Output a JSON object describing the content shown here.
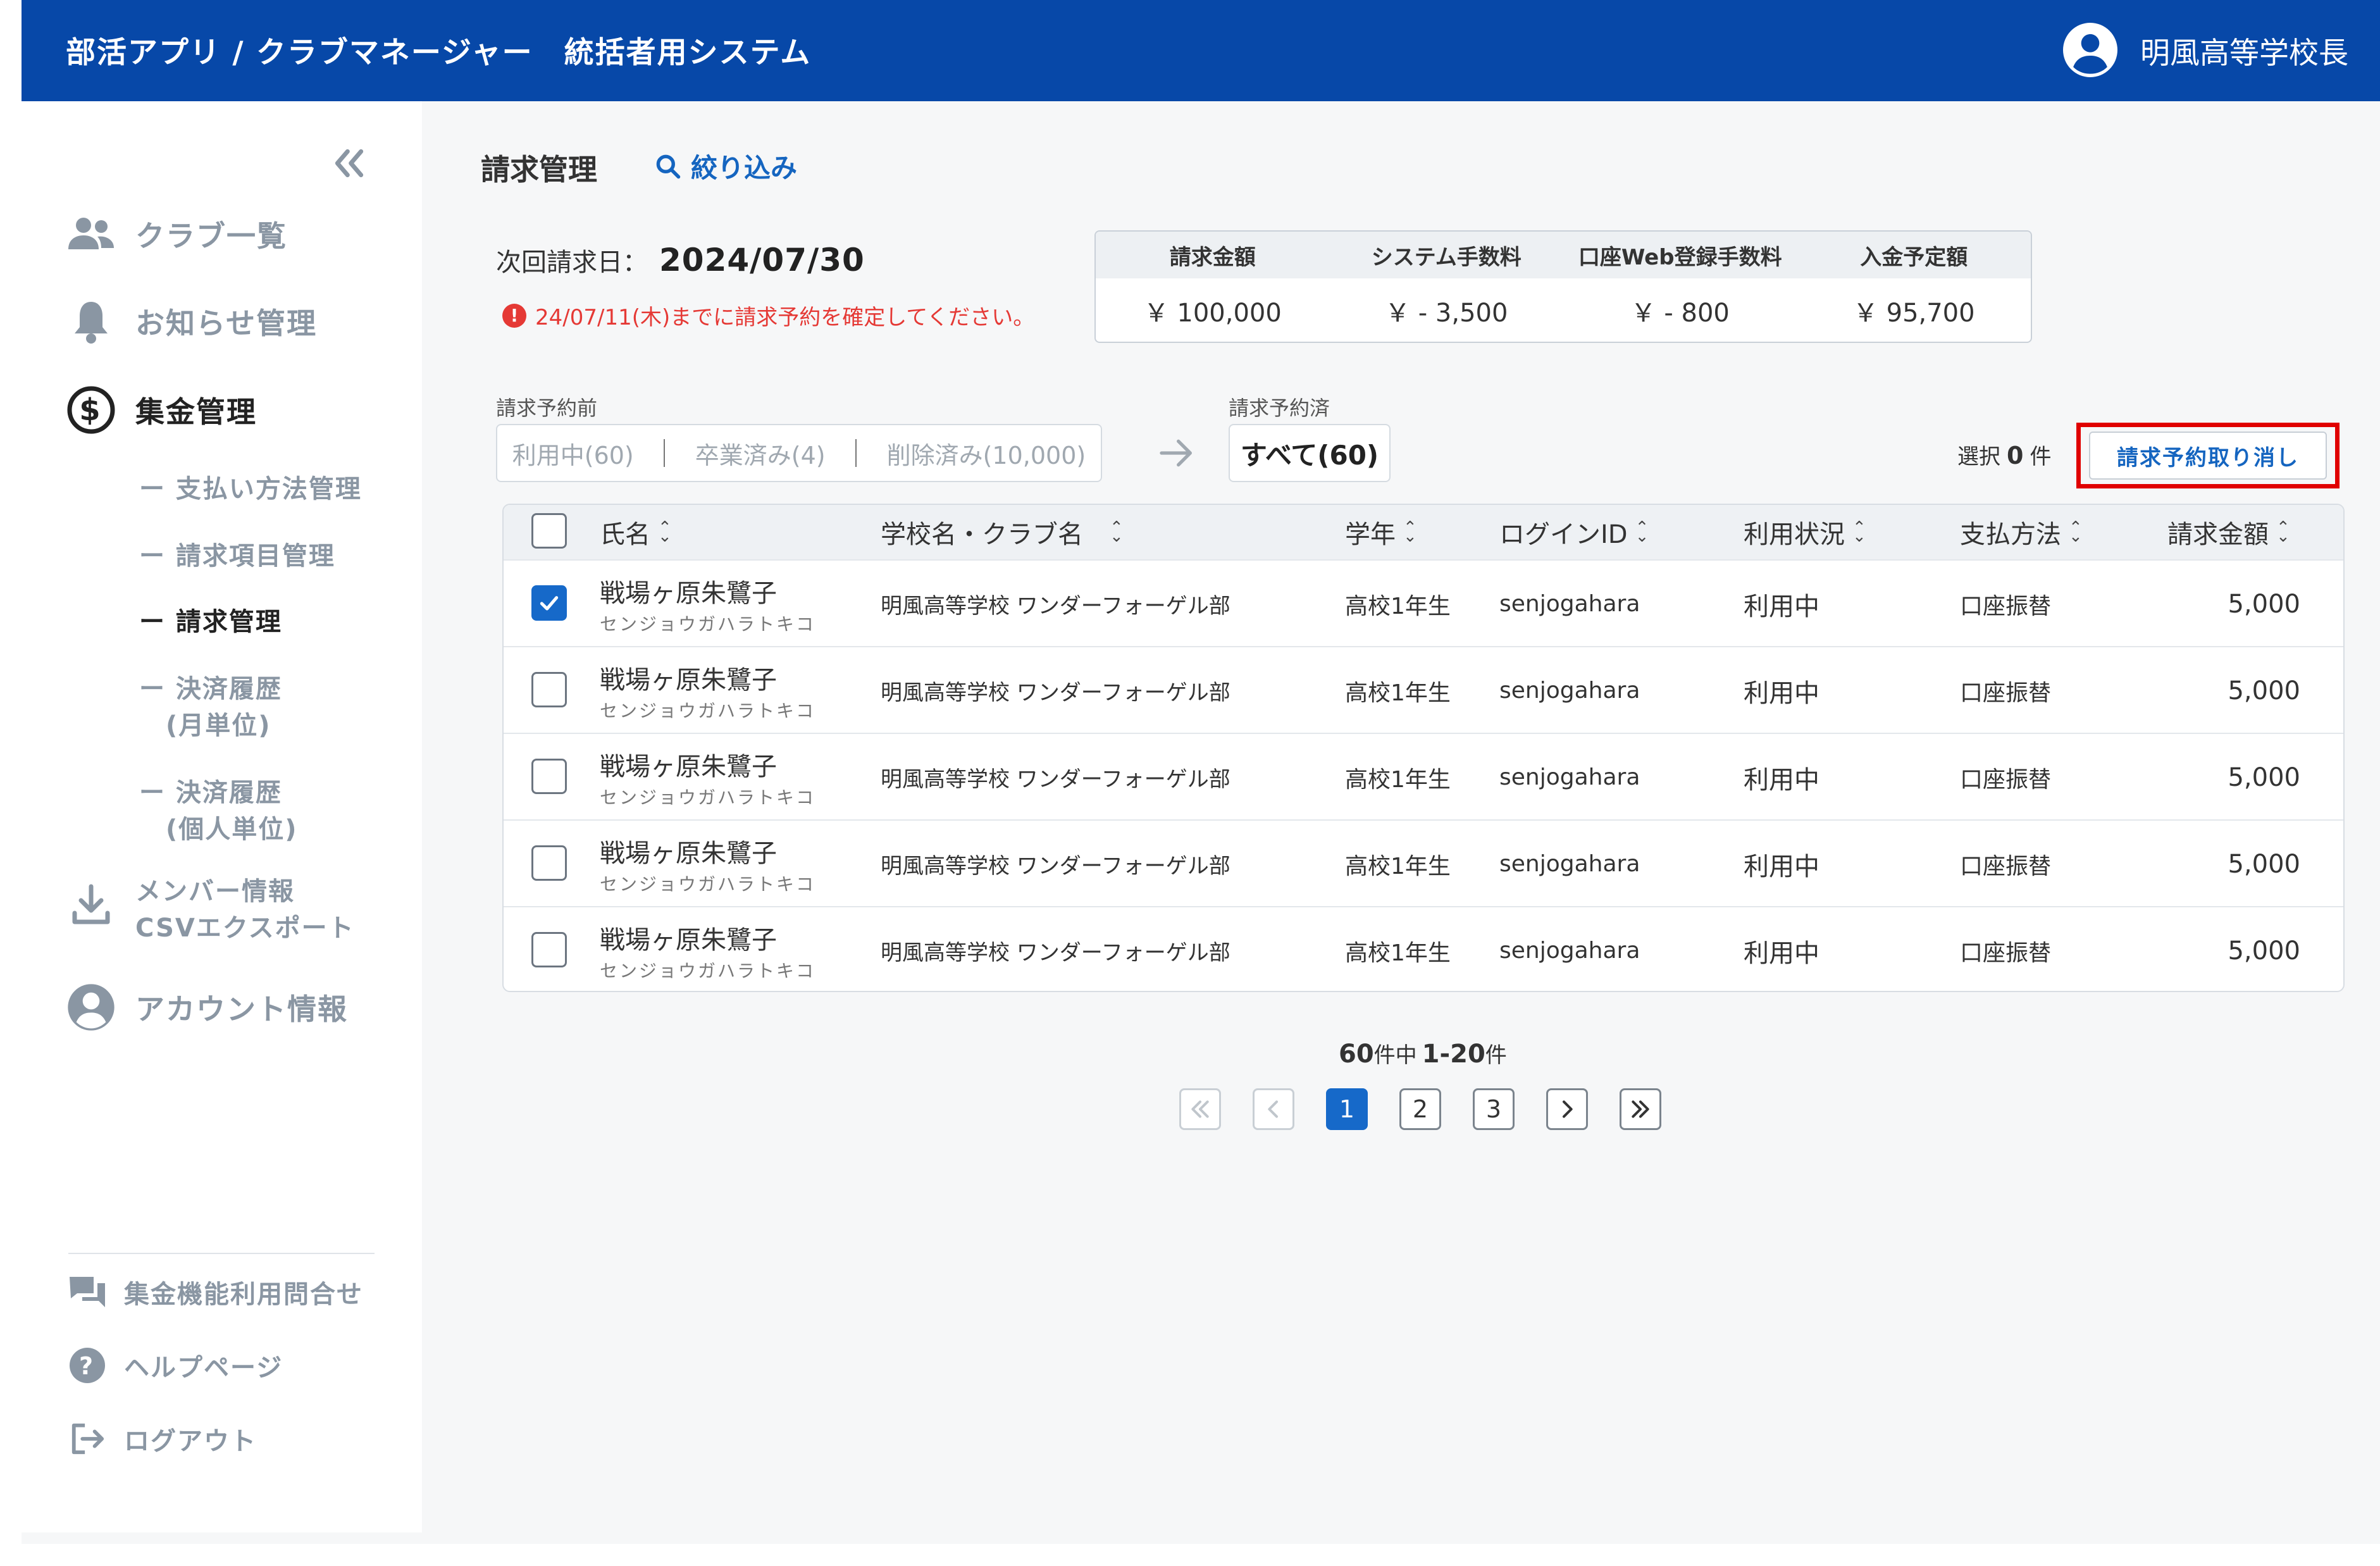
{
  "header": {
    "title": "部活アプリ / クラブマネージャー　統括者用システム",
    "user_name": "明風高等学校長"
  },
  "sidebar": {
    "items": [
      {
        "label": "クラブ一覧",
        "icon": "users-icon"
      },
      {
        "label": "お知らせ管理",
        "icon": "bell-icon"
      },
      {
        "label": "集金管理",
        "icon": "dollar-icon"
      },
      {
        "label": "メンバー情報",
        "label2": "CSVエクスポート",
        "icon": "download-icon"
      },
      {
        "label": "アカウント情報",
        "icon": "account-icon"
      }
    ],
    "subitems": [
      {
        "label": "ー 支払い方法管理"
      },
      {
        "label": "ー 請求項目管理"
      },
      {
        "label": "ー 請求管理"
      },
      {
        "label": "ー 決済履歴",
        "label2": "(月単位)"
      },
      {
        "label": "ー 決済履歴",
        "label2": "(個人単位)"
      }
    ],
    "bottom": [
      {
        "label": "集金機能利用問合せ",
        "icon": "chat-icon"
      },
      {
        "label": "ヘルプページ",
        "icon": "help-icon"
      },
      {
        "label": "ログアウト",
        "icon": "logout-icon"
      }
    ]
  },
  "main": {
    "title": "請求管理",
    "filter_label": "絞り込み",
    "next_date_label": "次回請求日：",
    "next_date_value": "2024/07/30",
    "warning": "24/07/11(木)までに請求予約を確定してください。",
    "summary": {
      "headers": [
        "請求金額",
        "システム手数料",
        "口座Web登録手数料",
        "入金予定額"
      ],
      "values": [
        "￥ 100,000",
        "￥ - 3,500",
        "￥ - 800",
        "￥ 95,700"
      ]
    },
    "before_label": "請求予約前",
    "before_segments": [
      "利用中(60)",
      "卒業済み(4)",
      "削除済み(10,000)"
    ],
    "after_label": "請求予約済",
    "after_segment": "すべて(60)",
    "selected_prefix": "選択",
    "selected_count": "0",
    "selected_suffix": "件",
    "cancel_button": "請求予約取り消し"
  },
  "table": {
    "columns": [
      "氏名",
      "学校名・クラブ名",
      "学年",
      "ログインID",
      "利用状況",
      "支払方法",
      "請求金額"
    ],
    "rows": [
      {
        "checked": true,
        "name": "戦場ヶ原朱鷺子",
        "kana": "センジョウガハラトキコ",
        "school": "明風高等学校 ワンダーフォーゲル部",
        "grade": "高校1年生",
        "login": "senjogahara",
        "status": "利用中",
        "payment": "口座振替",
        "amount": "5,000"
      },
      {
        "checked": false,
        "name": "戦場ヶ原朱鷺子",
        "kana": "センジョウガハラトキコ",
        "school": "明風高等学校 ワンダーフォーゲル部",
        "grade": "高校1年生",
        "login": "senjogahara",
        "status": "利用中",
        "payment": "口座振替",
        "amount": "5,000"
      },
      {
        "checked": false,
        "name": "戦場ヶ原朱鷺子",
        "kana": "センジョウガハラトキコ",
        "school": "明風高等学校 ワンダーフォーゲル部",
        "grade": "高校1年生",
        "login": "senjogahara",
        "status": "利用中",
        "payment": "口座振替",
        "amount": "5,000"
      },
      {
        "checked": false,
        "name": "戦場ヶ原朱鷺子",
        "kana": "センジョウガハラトキコ",
        "school": "明風高等学校 ワンダーフォーゲル部",
        "grade": "高校1年生",
        "login": "senjogahara",
        "status": "利用中",
        "payment": "口座振替",
        "amount": "5,000"
      },
      {
        "checked": false,
        "name": "戦場ヶ原朱鷺子",
        "kana": "センジョウガハラトキコ",
        "school": "明風高等学校 ワンダーフォーゲル部",
        "grade": "高校1年生",
        "login": "senjogahara",
        "status": "利用中",
        "payment": "口座振替",
        "amount": "5,000"
      }
    ]
  },
  "pagination": {
    "total": "60",
    "mid": "件中",
    "range": "1-20",
    "unit": "件",
    "pages": [
      "1",
      "2",
      "3"
    ],
    "current": "1"
  },
  "colors": {
    "header": "#0748a8",
    "accent": "#1669c9",
    "link": "#1565c0",
    "warning": "#e53935",
    "highlight": "#e00000"
  }
}
